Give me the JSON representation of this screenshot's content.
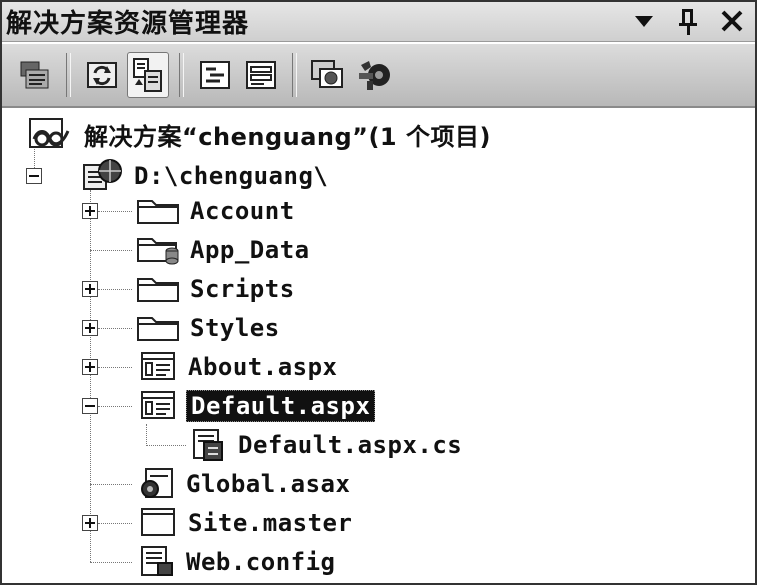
{
  "title": "解决方案资源管理器",
  "title_controls": {
    "dropdown": "▼",
    "pin": "ᵖ",
    "close": "✕"
  },
  "toolbar": {
    "buttons": [
      {
        "icon": "properties-icon"
      },
      {
        "icon": "refresh-icon"
      },
      {
        "icon": "nest-related-files-icon",
        "active": true
      },
      {
        "icon": "view-code-icon"
      },
      {
        "icon": "view-designer-icon"
      },
      {
        "icon": "copy-website-icon"
      },
      {
        "icon": "asp-net-configuration-icon"
      }
    ]
  },
  "tree": {
    "solution_label": "解决方案“chenguang”(1 个项目)",
    "project_label": "D:\\chenguang\\",
    "items": {
      "account": "Account",
      "app_data": "App_Data",
      "scripts": "Scripts",
      "styles": "Styles",
      "about": "About.aspx",
      "default": "Default.aspx",
      "default_cs": "Default.aspx.cs",
      "global": "Global.asax",
      "site_master": "Site.master",
      "web_config": "Web.config"
    },
    "selected": "Default.aspx"
  }
}
